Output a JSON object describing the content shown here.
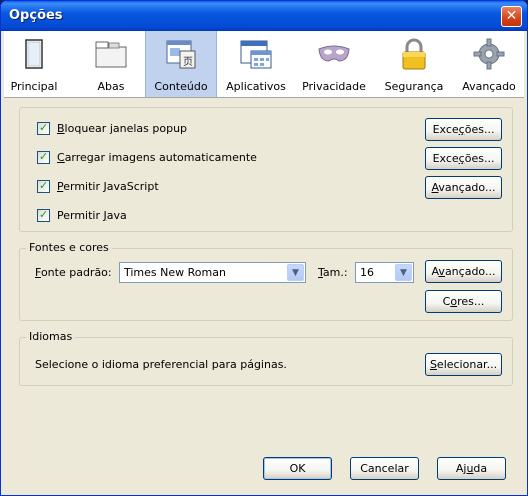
{
  "window": {
    "title": "Opções"
  },
  "toolbar": {
    "items": [
      {
        "label": "Principal",
        "icon": "window-icon"
      },
      {
        "label": "Abas",
        "icon": "tabs-icon"
      },
      {
        "label": "Conteúdo",
        "icon": "content-icon",
        "selected": true
      },
      {
        "label": "Aplicativos",
        "icon": "applications-icon"
      },
      {
        "label": "Privacidade",
        "icon": "mask-icon"
      },
      {
        "label": "Segurança",
        "icon": "lock-icon"
      },
      {
        "label": "Avançado",
        "icon": "gear-icon"
      }
    ]
  },
  "content": {
    "checks": [
      {
        "pre": "",
        "u": "B",
        "post": "loquear janelas popup",
        "checked": true
      },
      {
        "pre": "",
        "u": "C",
        "post": "arregar imagens automaticamente",
        "checked": true
      },
      {
        "pre": "",
        "u": "P",
        "post": "ermitir JavaScript",
        "checked": true
      },
      {
        "pre": "Permitir ",
        "u": "J",
        "post": "ava",
        "checked": true
      }
    ],
    "buttons": {
      "exceptions1": {
        "pre": "Exce",
        "u": "ç",
        "post": "ões..."
      },
      "exceptions2": {
        "pre": "Exce",
        "u": "ç",
        "post": "ões..."
      },
      "advanced_js": {
        "pre": "",
        "u": "A",
        "post": "vançado..."
      }
    }
  },
  "fonts": {
    "legend": "Fontes e cores",
    "default_font_label": {
      "pre": "",
      "u": "F",
      "post": "onte padrão:"
    },
    "default_font_value": "Times New Roman",
    "size_label": {
      "pre": "",
      "u": "T",
      "post": "am.:"
    },
    "size_value": "16",
    "advanced_button": {
      "pre": "A",
      "u": "v",
      "post": "ançado..."
    },
    "colors_button": {
      "pre": "C",
      "u": "o",
      "post": "res..."
    }
  },
  "languages": {
    "legend": "Idiomas",
    "description": "Selecione o idioma preferencial para páginas.",
    "select_button": {
      "pre": "",
      "u": "S",
      "post": "elecionar..."
    }
  },
  "footer": {
    "ok": "OK",
    "cancel": "Cancelar",
    "help": {
      "pre": "Aj",
      "u": "u",
      "post": "da"
    }
  },
  "colors": {
    "title_bar": "#0858e0",
    "dialog_bg": "#ece9d8",
    "selected_tab": "#c1d2ee"
  }
}
